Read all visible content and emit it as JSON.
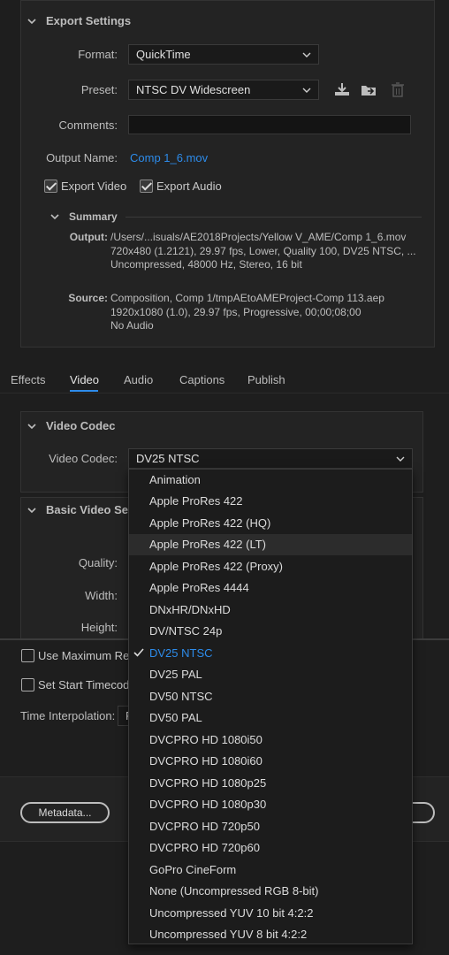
{
  "export_settings": {
    "title": "Export Settings",
    "format_label": "Format:",
    "format_value": "QuickTime",
    "preset_label": "Preset:",
    "preset_value": "NTSC DV Widescreen",
    "comments_label": "Comments:",
    "comments_value": "",
    "output_name_label": "Output Name:",
    "output_name_value": "Comp 1_6.mov",
    "export_video_label": "Export Video",
    "export_video_checked": true,
    "export_audio_label": "Export Audio",
    "export_audio_checked": true,
    "summary": {
      "title": "Summary",
      "output_label": "Output:",
      "output_lines": [
        "/Users/...isuals/AE2018Projects/Yellow V_AME/Comp 1_6.mov",
        "720x480 (1.2121), 29.97 fps, Lower, Quality 100, DV25 NTSC, ...",
        "Uncompressed, 48000 Hz, Stereo, 16 bit"
      ],
      "source_label": "Source:",
      "source_lines": [
        "Composition, Comp 1/tmpAEtoAMEProject-Comp 113.aep",
        "1920x1080 (1.0), 29.97 fps, Progressive, 00;00;08;00",
        "No Audio"
      ]
    }
  },
  "tabs": {
    "items": [
      "Effects",
      "Video",
      "Audio",
      "Captions",
      "Publish"
    ],
    "active": "Video"
  },
  "video_codec": {
    "title": "Video Codec",
    "label": "Video Codec:",
    "value": "DV25 NTSC"
  },
  "basic_video": {
    "title": "Basic Video Setti",
    "quality_label": "Quality:",
    "width_label": "Width:",
    "height_label": "Height:"
  },
  "lower": {
    "use_max_render_label": "Use Maximum Ren",
    "set_start_timecode_label": "Set Start Timecode",
    "time_interp_label": "Time Interpolation:",
    "time_interp_value": "F",
    "metadata_button": "Metadata..."
  },
  "codec_menu": {
    "items": [
      "Animation",
      "Apple ProRes 422",
      "Apple ProRes 422 (HQ)",
      "Apple ProRes 422 (LT)",
      "Apple ProRes 422 (Proxy)",
      "Apple ProRes 4444",
      "DNxHR/DNxHD",
      "DV/NTSC 24p",
      "DV25 NTSC",
      "DV25 PAL",
      "DV50 NTSC",
      "DV50 PAL",
      "DVCPRO HD 1080i50",
      "DVCPRO HD 1080i60",
      "DVCPRO HD 1080p25",
      "DVCPRO HD 1080p30",
      "DVCPRO HD 720p50",
      "DVCPRO HD 720p60",
      "GoPro CineForm",
      "None (Uncompressed RGB 8-bit)",
      "Uncompressed YUV 10 bit 4:2:2",
      "Uncompressed YUV 8 bit 4:2:2"
    ],
    "selected": "DV25 NTSC",
    "hovered": "Apple ProRes 422 (LT)"
  },
  "colors": {
    "accent": "#2d8ceb",
    "background": "#1e1e1e",
    "panel": "#232323"
  }
}
